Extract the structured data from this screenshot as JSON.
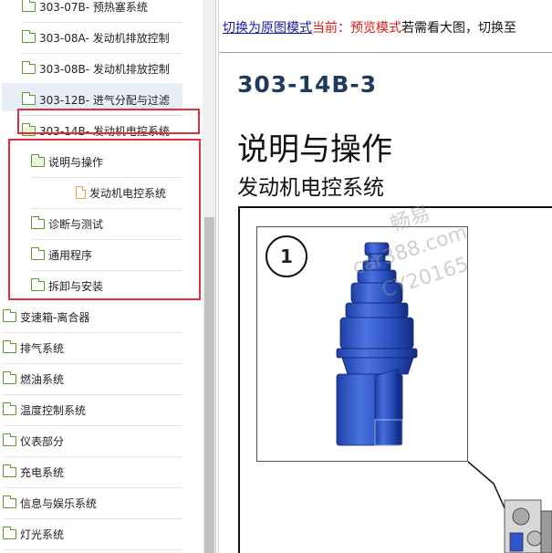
{
  "tree": {
    "items": [
      {
        "label": "303-07B- 预热塞系统",
        "icon": "folder-icon"
      },
      {
        "label": "303-08A- 发动机排放控制",
        "icon": "folder-icon"
      },
      {
        "label": "303-08B- 发动机排放控制",
        "icon": "folder-icon"
      },
      {
        "label": "303-12B- 进气分配与过滤",
        "icon": "folder-icon"
      },
      {
        "label": "303-14B- 发动机电控系统",
        "icon": "folder-open-icon"
      },
      {
        "label": "说明与操作",
        "icon": "folder-open-icon"
      },
      {
        "label": "发动机电控系统",
        "icon": "document-icon"
      },
      {
        "label": "诊断与测试",
        "icon": "folder-icon"
      },
      {
        "label": "通用程序",
        "icon": "folder-icon"
      },
      {
        "label": "拆卸与安装",
        "icon": "folder-icon"
      },
      {
        "label": "变速箱-离合器",
        "icon": "folder-icon"
      },
      {
        "label": "排气系统",
        "icon": "folder-icon"
      },
      {
        "label": "燃油系统",
        "icon": "folder-icon"
      },
      {
        "label": "温度控制系统",
        "icon": "folder-icon"
      },
      {
        "label": "仪表部分",
        "icon": "folder-icon"
      },
      {
        "label": "充电系统",
        "icon": "folder-icon"
      },
      {
        "label": "信息与娱乐系统",
        "icon": "folder-icon"
      },
      {
        "label": "灯光系统",
        "icon": "folder-icon"
      }
    ]
  },
  "topbar": {
    "link": "切换为原图模式",
    "current": "当前：预览模式",
    "tail": "若需看大图，切换至"
  },
  "document": {
    "number": "303-14B-3",
    "title": "说明与操作",
    "subtitle": "发动机电控系统",
    "callout": "1"
  },
  "watermark": {
    "line1": "畅易",
    "line2": "car388.com",
    "line3": "CY20165"
  },
  "colors": {
    "annotation_red": "#e0303a",
    "folder_green": "#5a9b2a",
    "document_orange": "#f0a24a",
    "part_blue": "#2f56c8",
    "link_blue": "#1a1aa6",
    "status_red": "#e01818"
  }
}
